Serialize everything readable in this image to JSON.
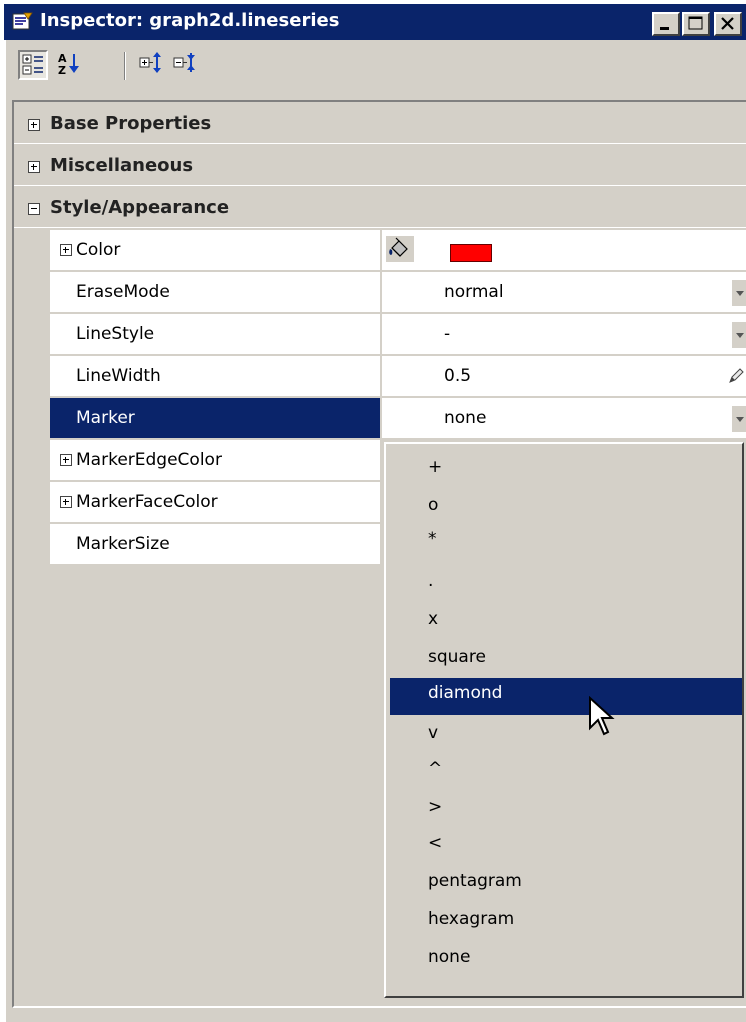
{
  "window": {
    "title": "Inspector: graph2d.lineseries",
    "controls": [
      "minimize-icon",
      "maximize-icon",
      "close-icon"
    ]
  },
  "toolbar": {
    "buttons": [
      "categorized-view-icon",
      "sort-alphabetical-icon",
      "expand-all-icon",
      "collapse-all-icon"
    ],
    "active": "categorized-view-icon"
  },
  "categories": [
    {
      "label": "Base Properties",
      "expanded": false
    },
    {
      "label": "Miscellaneous",
      "expanded": false
    },
    {
      "label": "Style/Appearance",
      "expanded": true
    }
  ],
  "properties": [
    {
      "name": "Color",
      "value": "",
      "expandable": true,
      "editor": "color",
      "swatch_color": "#ff0000"
    },
    {
      "name": "EraseMode",
      "value": "normal",
      "expandable": false,
      "editor": "dropdown"
    },
    {
      "name": "LineStyle",
      "value": "-",
      "expandable": false,
      "editor": "dropdown"
    },
    {
      "name": "LineWidth",
      "value": "0.5",
      "expandable": false,
      "editor": "edit"
    },
    {
      "name": "Marker",
      "value": "none",
      "expandable": false,
      "editor": "dropdown",
      "selected": true
    },
    {
      "name": "MarkerEdgeColor",
      "value": "",
      "expandable": true
    },
    {
      "name": "MarkerFaceColor",
      "value": "",
      "expandable": true
    },
    {
      "name": "MarkerSize",
      "value": "",
      "expandable": false
    }
  ],
  "marker_dropdown": {
    "options": [
      "+",
      "o",
      "*",
      ".",
      "x",
      "square",
      "diamond",
      "v",
      "^",
      ">",
      "<",
      "pentagram",
      "hexagram",
      "none"
    ],
    "highlighted": "diamond"
  },
  "colors": {
    "title_bar": "#0a246a",
    "selection": "#0a246a",
    "face": "#d4d0c8"
  }
}
